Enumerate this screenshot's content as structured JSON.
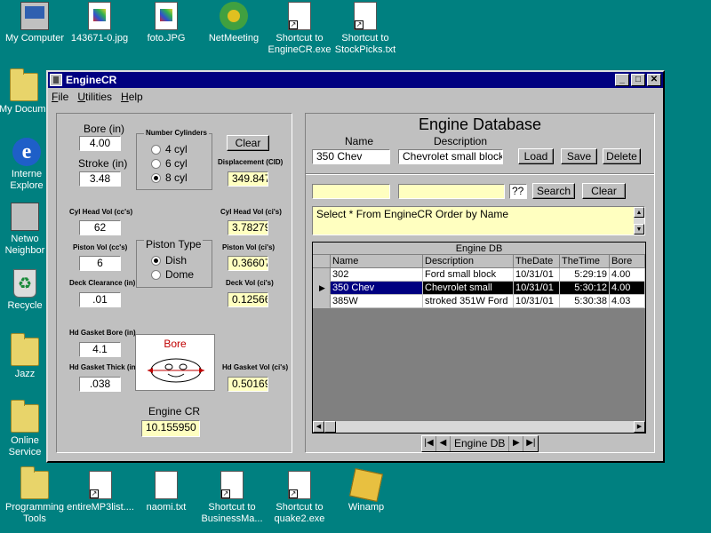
{
  "desktop": {
    "icons": [
      {
        "label": "My Computer"
      },
      {
        "label": "143671-0.jpg"
      },
      {
        "label": "foto.JPG"
      },
      {
        "label": "NetMeeting"
      },
      {
        "label": "Shortcut to EngineCR.exe"
      },
      {
        "label": "Shortcut to StockPicks.txt"
      },
      {
        "label": "My Docum"
      },
      {
        "label": "Interne Explore"
      },
      {
        "label": "Netwo Neighbor"
      },
      {
        "label": "Recycle"
      },
      {
        "label": "Jazz"
      },
      {
        "label": "Online Service"
      },
      {
        "label": "Programming Tools"
      },
      {
        "label": "entireMP3list...."
      },
      {
        "label": "naomi.txt"
      },
      {
        "label": "Shortcut to BusinessMa..."
      },
      {
        "label": "Shortcut to quake2.exe"
      },
      {
        "label": "Winamp"
      }
    ]
  },
  "window": {
    "title": "EngineCR",
    "menu": [
      "File",
      "Utilities",
      "Help"
    ]
  },
  "calc": {
    "bore_label": "Bore (in)",
    "bore": "4.00",
    "stroke_label": "Stroke (in)",
    "stroke": "3.48",
    "cyl_group": "Number Cylinders",
    "cyl_options": [
      "4 cyl",
      "6 cyl",
      "8 cyl"
    ],
    "cyl_selected": 2,
    "clear_label": "Clear",
    "displacement_label": "Displacement (CID)",
    "displacement": "349.847",
    "cyl_head_cc_label": "Cyl Head Vol (cc's)",
    "cyl_head_cc": "62",
    "cyl_head_ci_label": "Cyl Head Vol (ci's)",
    "cyl_head_ci": "3.78279",
    "piston_cc_label": "Piston Vol (cc's)",
    "piston_cc": "6",
    "piston_type_group": "Piston Type",
    "piston_options": [
      "Dish",
      "Dome"
    ],
    "piston_selected": 0,
    "piston_ci_label": "Piston Vol (ci's)",
    "piston_ci": "0.36607",
    "deck_clear_label": "Deck Clearance (in)",
    "deck_clear": ".01",
    "deck_vol_label": "Deck Vol (ci's)",
    "deck_vol": "0.12566",
    "gasket_bore_label": "Hd Gasket Bore (in)",
    "gasket_bore": "4.1",
    "gasket_thick_label": "Hd Gasket Thick (in)",
    "gasket_thick": ".038",
    "bore_diagram_label": "Bore",
    "gasket_vol_label": "Hd Gasket Vol (ci's)",
    "gasket_vol": "0.50169",
    "engine_cr_label": "Engine CR",
    "engine_cr": "10.155950"
  },
  "db": {
    "title": "Engine Database",
    "name_label": "Name",
    "name": "350 Chev",
    "desc_label": "Description",
    "desc": "Chevrolet small block",
    "load": "Load",
    "save": "Save",
    "delete": "Delete",
    "search_1": "",
    "search_2": "",
    "qq": "??",
    "search_btn": "Search",
    "clear_btn": "Clear",
    "sql": "Select * From EngineCR Order by Name",
    "grid_caption": "Engine DB",
    "columns": [
      "Name",
      "Description",
      "TheDate",
      "TheTime",
      "Bore"
    ],
    "rows": [
      {
        "name": "302",
        "desc": "Ford small block",
        "date": "10/31/01",
        "time": "5:29:19",
        "bore": "4.00"
      },
      {
        "name": "350 Chev",
        "desc": "Chevrolet small",
        "date": "10/31/01",
        "time": "5:30:12",
        "bore": "4.00"
      },
      {
        "name": "385W",
        "desc": "stroked 351W Ford",
        "date": "10/31/01",
        "time": "5:30:38",
        "bore": "4.03"
      }
    ],
    "selected_row": 1,
    "tab_label": "Engine DB"
  }
}
